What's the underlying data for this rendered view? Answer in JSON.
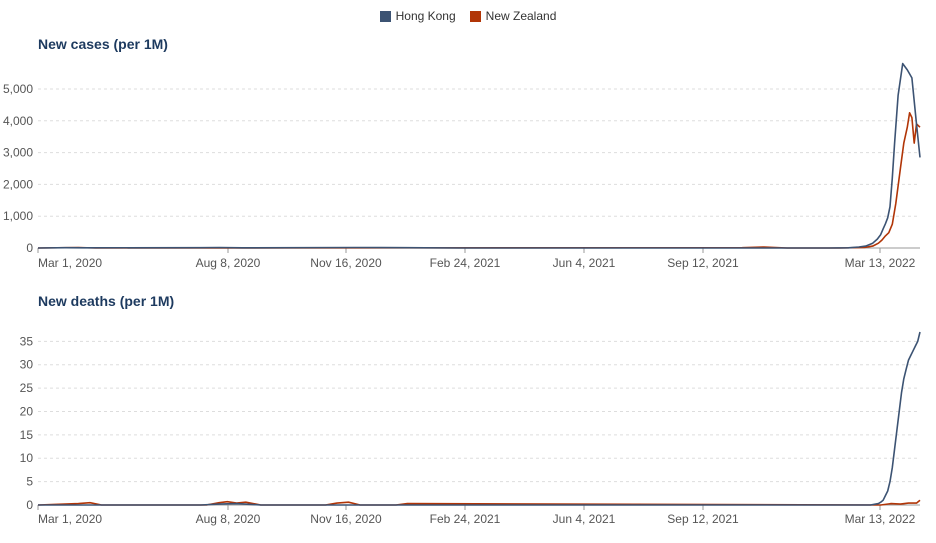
{
  "legend": [
    {
      "label": "Hong Kong",
      "color": "#3c5373"
    },
    {
      "label": "New Zealand",
      "color": "#b13507"
    }
  ],
  "chart_data": [
    {
      "type": "line",
      "title": "New cases (per 1M)",
      "x_ticks": [
        "Mar 1, 2020",
        "Aug 8, 2020",
        "Nov 16, 2020",
        "Feb 24, 2021",
        "Jun 4, 2021",
        "Sep 12, 2021",
        "Mar 13, 2022"
      ],
      "y_ticks": [
        "0",
        "1,000",
        "2,000",
        "3,000",
        "4,000",
        "5,000"
      ],
      "xlim": [
        "2020-03-01",
        "2022-04-04"
      ],
      "ylim": [
        0,
        5000
      ],
      "grid": true,
      "legend": "top-center",
      "series": [
        {
          "name": "Hong Kong",
          "color": "#3c5373",
          "x": [
            "2020-03-01",
            "2020-03-25",
            "2020-04-10",
            "2020-07-20",
            "2020-08-05",
            "2020-08-25",
            "2020-12-01",
            "2021-01-15",
            "2021-03-01",
            "2022-01-15",
            "2022-02-01",
            "2022-02-10",
            "2022-02-16",
            "2022-02-22",
            "2022-02-26",
            "2022-03-01",
            "2022-03-03",
            "2022-03-05",
            "2022-03-07",
            "2022-03-09",
            "2022-03-11",
            "2022-03-13",
            "2022-03-16",
            "2022-03-20",
            "2022-03-24",
            "2022-03-28",
            "2022-04-01",
            "2022-04-04"
          ],
          "y": [
            0,
            10,
            5,
            10,
            15,
            5,
            15,
            10,
            0,
            0,
            5,
            30,
            60,
            150,
            280,
            420,
            600,
            760,
            950,
            1300,
            2200,
            3300,
            4800,
            5800,
            5600,
            5350,
            3900,
            2850
          ]
        },
        {
          "name": "New Zealand",
          "color": "#b13507",
          "x": [
            "2020-03-01",
            "2020-04-05",
            "2020-04-20",
            "2021-11-01",
            "2021-11-20",
            "2021-12-10",
            "2022-01-25",
            "2022-02-15",
            "2022-02-22",
            "2022-02-27",
            "2022-03-02",
            "2022-03-05",
            "2022-03-08",
            "2022-03-11",
            "2022-03-14",
            "2022-03-18",
            "2022-03-21",
            "2022-03-24",
            "2022-03-26",
            "2022-03-28",
            "2022-03-30",
            "2022-04-01",
            "2022-04-04"
          ],
          "y": [
            0,
            15,
            0,
            10,
            30,
            0,
            0,
            20,
            60,
            150,
            250,
            380,
            480,
            750,
            1400,
            2500,
            3300,
            3800,
            4250,
            4100,
            3300,
            3900,
            3800
          ]
        }
      ]
    },
    {
      "type": "line",
      "title": "New deaths (per 1M)",
      "x_ticks": [
        "Mar 1, 2020",
        "Aug 8, 2020",
        "Nov 16, 2020",
        "Feb 24, 2021",
        "Jun 4, 2021",
        "Sep 12, 2021",
        "Mar 13, 2022"
      ],
      "y_ticks": [
        "0",
        "5",
        "10",
        "15",
        "20",
        "25",
        "30",
        "35"
      ],
      "xlim": [
        "2020-03-01",
        "2022-04-04"
      ],
      "ylim": [
        0,
        37
      ],
      "grid": true,
      "series": [
        {
          "name": "Hong Kong",
          "color": "#3c5373",
          "x": [
            "2020-03-01",
            "2020-07-20",
            "2020-08-05",
            "2020-08-20",
            "2020-09-10",
            "2022-02-20",
            "2022-02-27",
            "2022-03-01",
            "2022-03-03",
            "2022-03-05",
            "2022-03-07",
            "2022-03-09",
            "2022-03-11",
            "2022-03-13",
            "2022-03-15",
            "2022-03-17",
            "2022-03-19",
            "2022-03-21",
            "2022-03-23",
            "2022-03-25",
            "2022-03-27",
            "2022-03-29",
            "2022-03-31",
            "2022-04-02",
            "2022-04-04"
          ],
          "y": [
            0,
            0,
            0.2,
            0.3,
            0,
            0,
            0.3,
            0.6,
            1,
            2,
            3,
            5,
            8,
            12,
            16,
            20,
            24,
            27,
            29,
            31,
            32,
            33,
            34,
            35,
            37
          ]
        },
        {
          "name": "New Zealand",
          "color": "#b13507",
          "x": [
            "2020-03-01",
            "2020-04-05",
            "2020-04-15",
            "2020-04-25",
            "2020-07-25",
            "2020-08-05",
            "2020-08-12",
            "2020-08-20",
            "2020-08-28",
            "2020-09-10",
            "2020-11-05",
            "2020-11-15",
            "2020-11-25",
            "2020-12-05",
            "2021-01-05",
            "2021-01-15",
            "2022-03-01",
            "2022-03-10",
            "2022-03-18",
            "2022-03-25",
            "2022-04-01",
            "2022-04-04"
          ],
          "y": [
            0,
            0.3,
            0.5,
            0,
            0,
            0.5,
            0.7,
            0.4,
            0.6,
            0,
            0,
            0.4,
            0.6,
            0,
            0,
            0.3,
            0,
            0.3,
            0.2,
            0.4,
            0.4,
            1
          ]
        }
      ]
    }
  ]
}
